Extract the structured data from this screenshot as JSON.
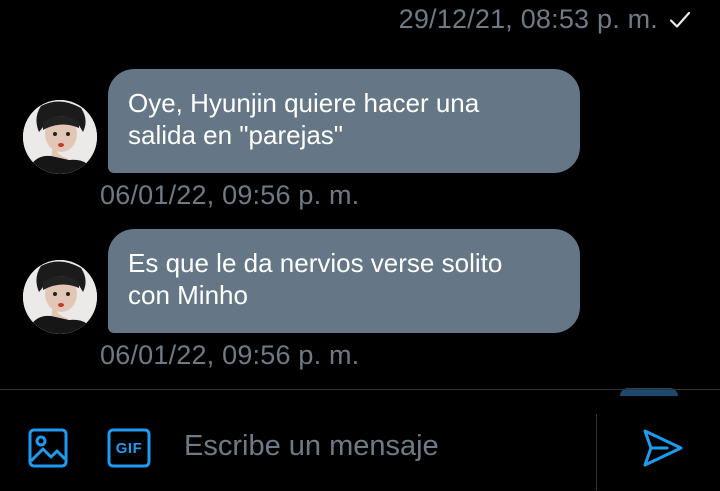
{
  "colors": {
    "background": "#000000",
    "bubble": "#657786",
    "meta_text": "#6e7a86",
    "accent": "#1d9bf0",
    "divider": "#2f3336"
  },
  "previous_message": {
    "timestamp": "29/12/21, 08:53 p. m.",
    "status_icon": "check-icon"
  },
  "messages": [
    {
      "lines": [
        "Oye, Hyunjin quiere hacer una",
        "salida en \"parejas\""
      ],
      "timestamp": "06/01/22, 09:56 p. m.",
      "avatar_icon": "avatar"
    },
    {
      "lines": [
        "Es que le da nervios verse solito",
        "con Minho"
      ],
      "timestamp": "06/01/22, 09:56 p. m.",
      "avatar_icon": "avatar"
    }
  ],
  "composer": {
    "placeholder": "Escribe un mensaje",
    "image_icon": "image-icon",
    "gif_label": "GIF",
    "send_icon": "send-icon"
  }
}
